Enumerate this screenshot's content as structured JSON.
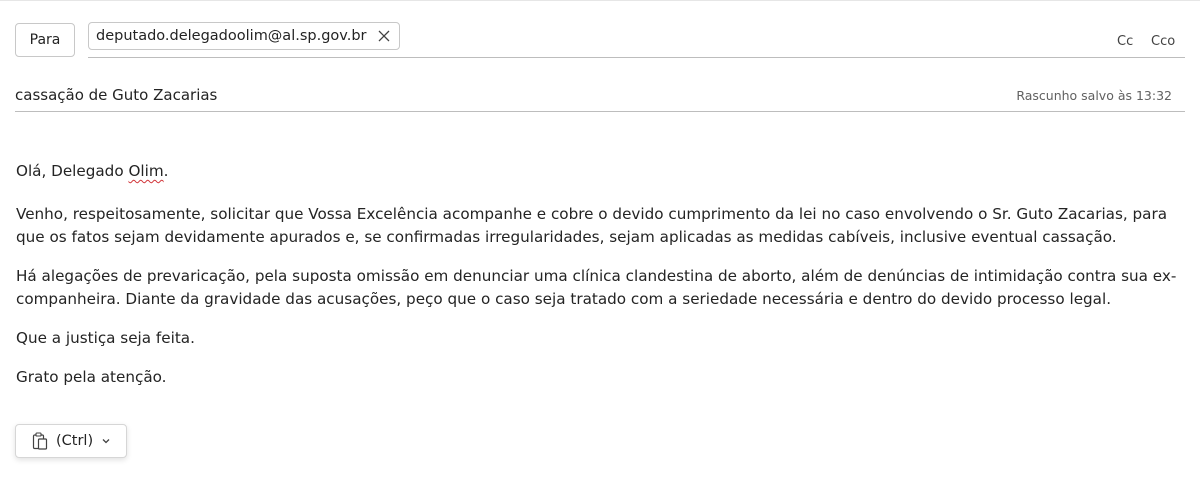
{
  "compose": {
    "to_label": "Para",
    "recipient": "deputado.delegadoolim@al.sp.gov.br",
    "cc_label": "Cc",
    "bcc_label": "Cco",
    "subject": "cassação de Guto Zacarias",
    "draft_status": "Rascunho salvo às 13:32"
  },
  "body": {
    "greeting_prefix": "Olá, Delegado ",
    "greeting_name": "Olim",
    "greeting_suffix": ".",
    "paragraph_1": "Venho, respeitosamente, solicitar que Vossa Excelência acompanhe e cobre o devido cumprimento da lei no caso envolvendo o Sr. Guto Zacarias, para que os fatos sejam devidamente apurados e, se confirmadas irregularidades, sejam aplicadas as medidas cabíveis, inclusive eventual cassação.",
    "paragraph_2": "Há alegações de prevaricação, pela suposta omissão em denunciar uma clínica clandestina de aborto, além de denúncias de intimidação contra sua ex-companheira. Diante da gravidade das acusações, peço que o caso seja tratado com a seriedade necessária e dentro do devido processo legal.",
    "paragraph_3": "Que a justiça seja feita.",
    "closing": "Grato pela atenção."
  },
  "paste_options": {
    "label": "(Ctrl)",
    "icon": "clipboard-icon"
  },
  "colors": {
    "text": "#242424",
    "border": "#c8c8c8",
    "spellcheck": "#d13438"
  }
}
